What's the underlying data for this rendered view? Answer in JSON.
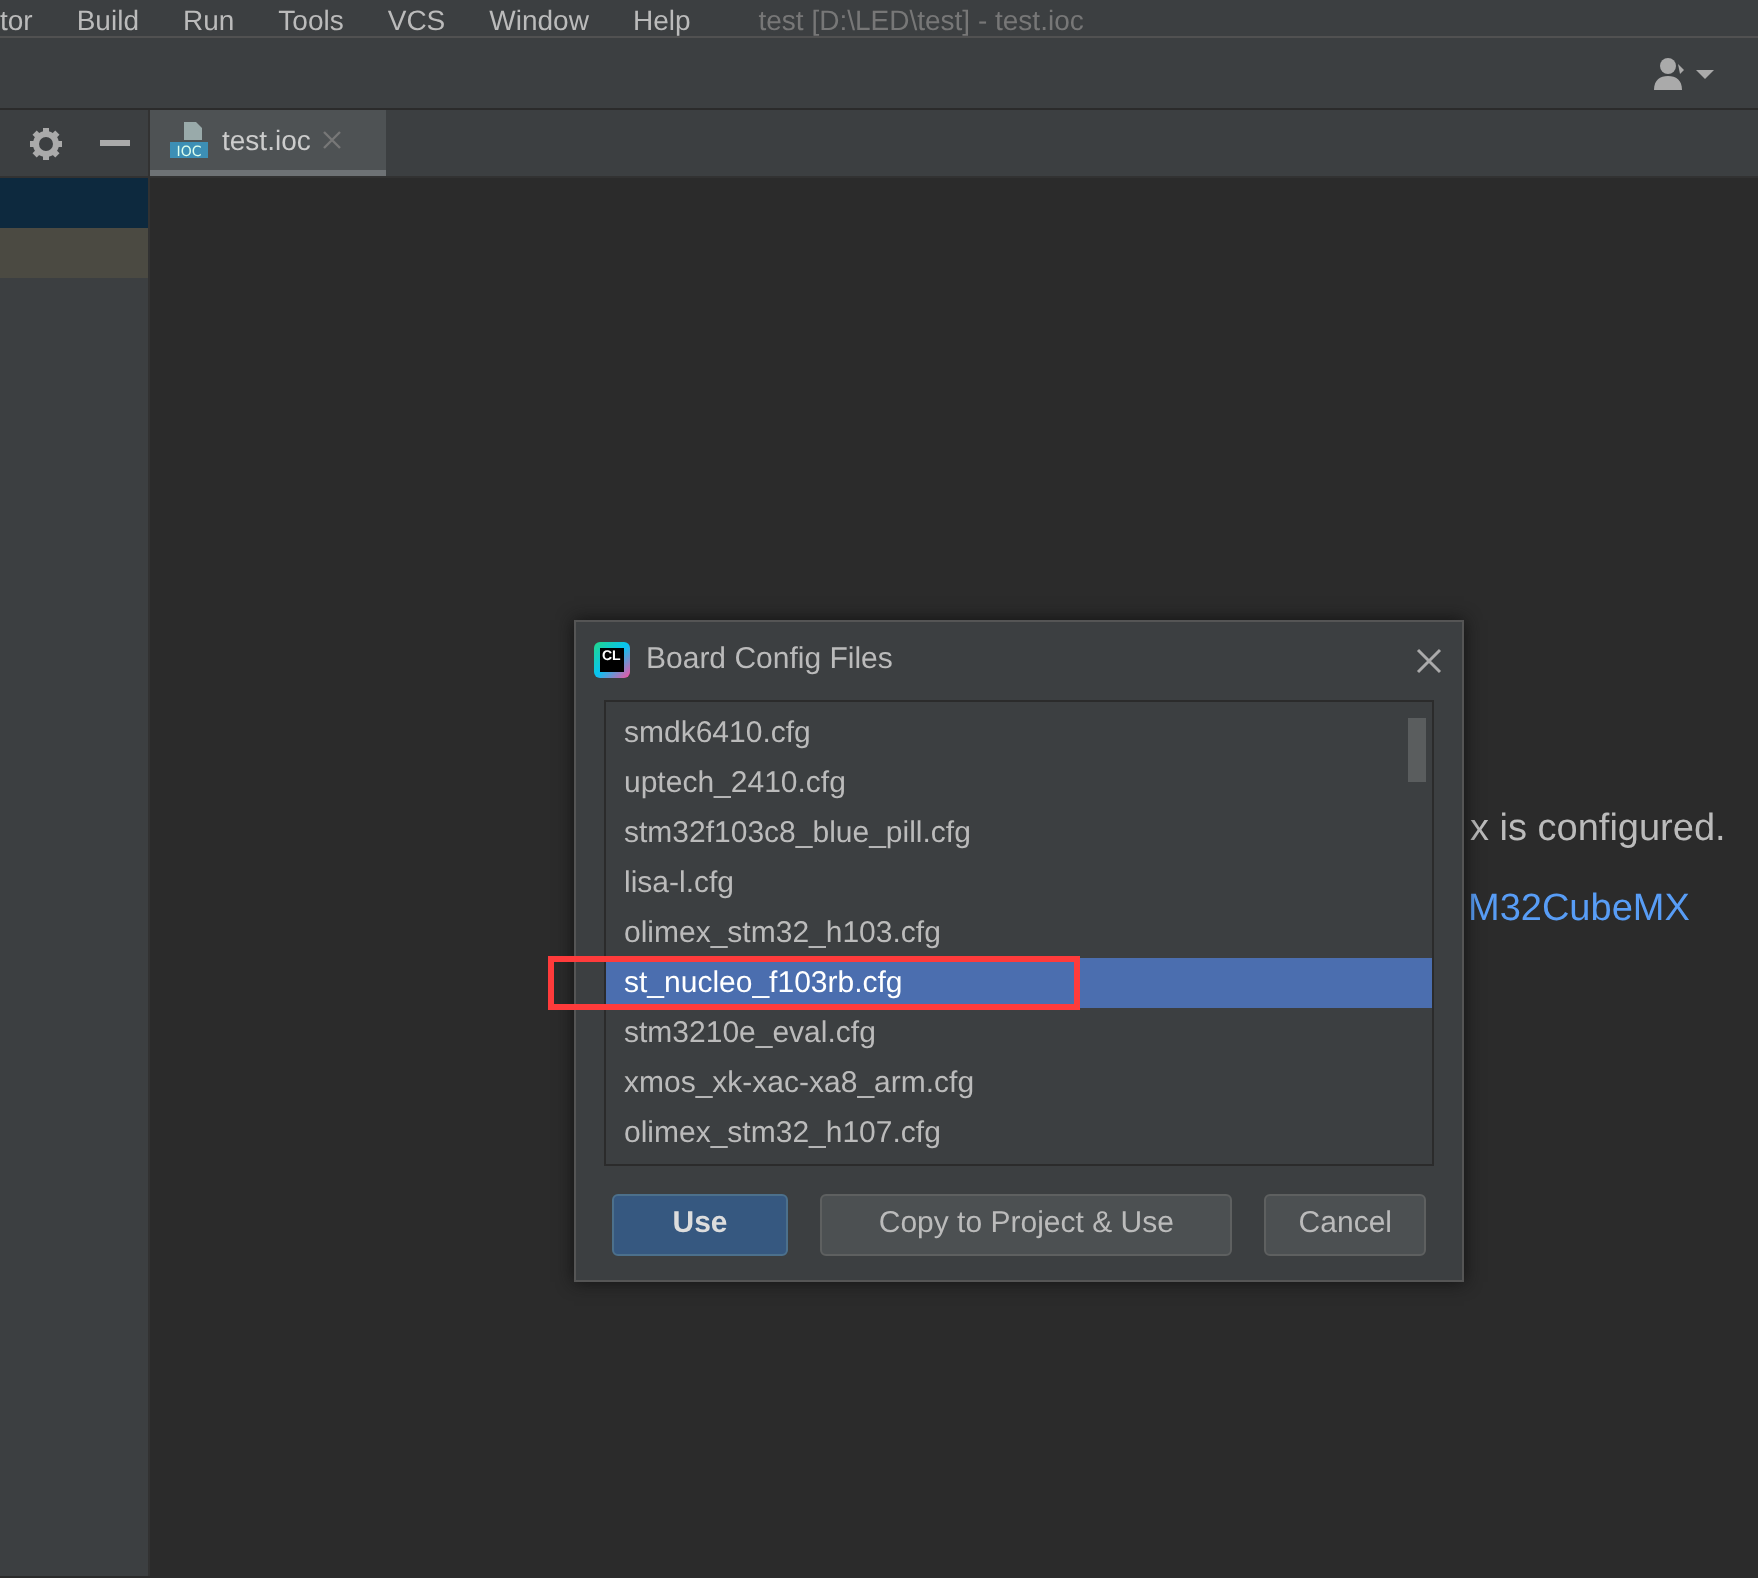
{
  "menu": [
    {
      "label": "tor"
    },
    {
      "label": "Build"
    },
    {
      "label": "Run"
    },
    {
      "label": "Tools"
    },
    {
      "label": "VCS"
    },
    {
      "label": "Window"
    },
    {
      "label": "Help"
    }
  ],
  "window": {
    "title": "test [D:\\LED\\test] - test.ioc"
  },
  "tabs": [
    {
      "label": "test.ioc",
      "badge": "IOC",
      "selected": true
    }
  ],
  "editor": {
    "message": "x is configured.",
    "link": "M32CubeMX"
  },
  "dialog": {
    "title": "Board Config Files",
    "app_icon": "CL",
    "items": [
      {
        "label": "smdk6410.cfg",
        "selected": false
      },
      {
        "label": "uptech_2410.cfg",
        "selected": false
      },
      {
        "label": "stm32f103c8_blue_pill.cfg",
        "selected": false
      },
      {
        "label": "lisa-l.cfg",
        "selected": false
      },
      {
        "label": "olimex_stm32_h103.cfg",
        "selected": false
      },
      {
        "label": "st_nucleo_f103rb.cfg",
        "selected": true
      },
      {
        "label": "stm3210e_eval.cfg",
        "selected": false
      },
      {
        "label": "xmos_xk-xac-xa8_arm.cfg",
        "selected": false
      },
      {
        "label": "olimex_stm32_h107.cfg",
        "selected": false
      }
    ],
    "buttons": [
      {
        "label": "Use",
        "kind": "default"
      },
      {
        "label": "Copy to Project & Use",
        "kind": "normal"
      },
      {
        "label": "Cancel",
        "kind": "normal"
      }
    ]
  }
}
